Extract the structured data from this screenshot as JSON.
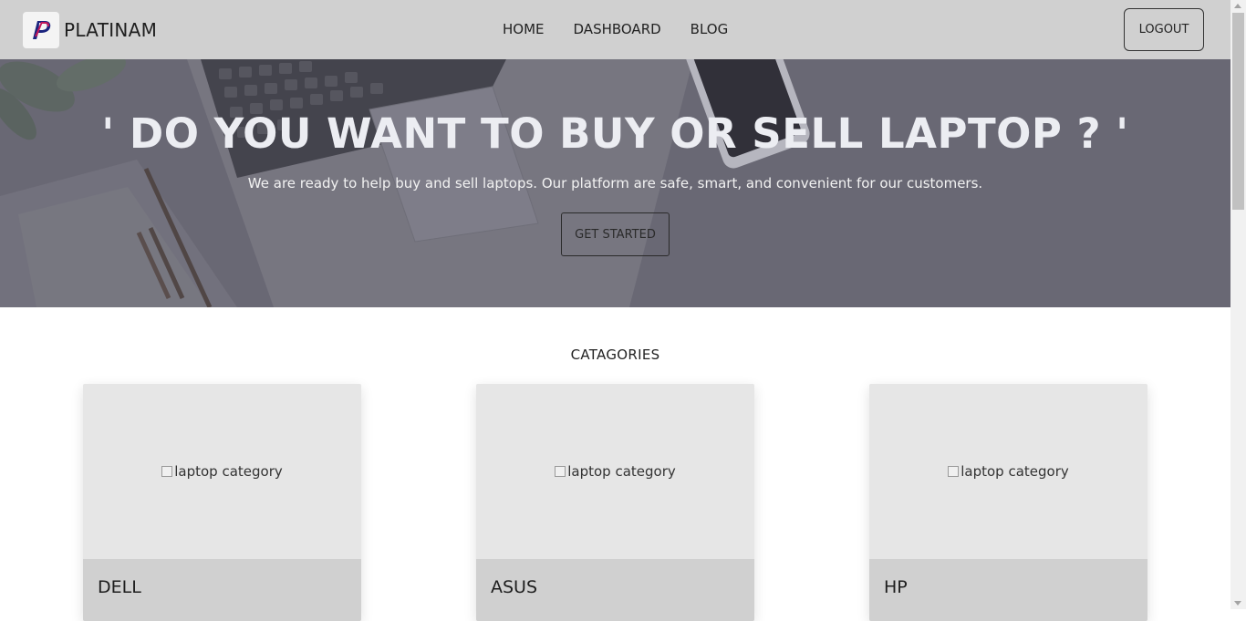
{
  "navbar": {
    "brand_name": "PLATINAM",
    "logo_icon": "platinam-p-logo",
    "links": [
      {
        "label": "HOME"
      },
      {
        "label": "DASHBOARD"
      },
      {
        "label": "BLOG"
      }
    ],
    "logout_label": "LOGOUT"
  },
  "hero": {
    "title": "' DO YOU WANT TO BUY OR SELL LAPTOP ? '",
    "subtitle": "We are ready to help buy and sell laptops. Our platform are safe, smart, and convenient for our customers.",
    "cta_label": "GET STARTED"
  },
  "categories": {
    "heading": "CATAGORIES",
    "items": [
      {
        "name": "DELL",
        "image_alt": "laptop category"
      },
      {
        "name": "ASUS",
        "image_alt": "laptop category"
      },
      {
        "name": "HP",
        "image_alt": "laptop category"
      }
    ]
  },
  "colors": {
    "navbar_bg": "#d0d0d0",
    "hero_overlay": "#6e6c78",
    "card_bg": "#e6e6e6",
    "card_footer_bg": "#d0d0d0",
    "logo_magenta": "#c2185b",
    "logo_navy": "#1a237e"
  }
}
